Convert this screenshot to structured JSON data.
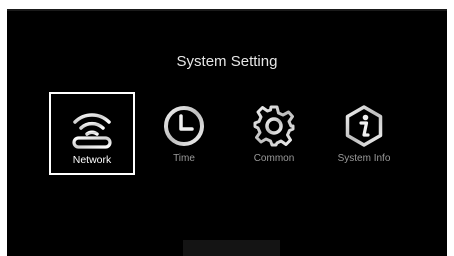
{
  "title": "System Setting",
  "menu": [
    {
      "label": "Network",
      "icon": "wifi-icon",
      "selected": true
    },
    {
      "label": "Time",
      "icon": "clock-icon",
      "selected": false
    },
    {
      "label": "Common",
      "icon": "gear-icon",
      "selected": false
    },
    {
      "label": "System Info",
      "icon": "info-icon",
      "selected": false
    }
  ],
  "colors": {
    "background": "#000000",
    "text": "#e6e6e6",
    "label_inactive": "#9a9a9a",
    "selection_border": "#ffffff"
  }
}
